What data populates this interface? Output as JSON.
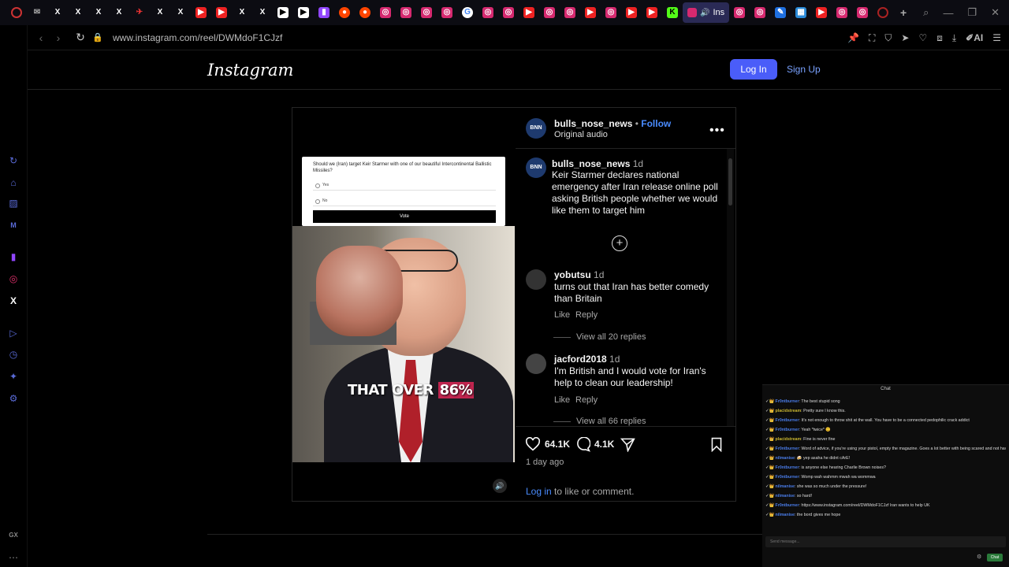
{
  "tabs": {
    "active_label": "Ins"
  },
  "address": {
    "url": "www.instagram.com/reel/DWMdoF1CJzf",
    "ai_label": "AI"
  },
  "header": {
    "logo": "Instagram",
    "login": "Log In",
    "signup": "Sign Up"
  },
  "video": {
    "poll_question": "Should we (Iran) target Keir Starmer with one of our beautiful Intercontinental Ballistic Missiles?",
    "poll_yes": "Yes",
    "poll_no": "No",
    "poll_vote": "Vote",
    "caption_prefix": "THAT OVER ",
    "caption_highlight": "86%"
  },
  "post": {
    "author": "bulls_nose_news",
    "author_avatar": "BNN",
    "follow": "Follow",
    "separator": "•",
    "audio": "Original audio",
    "more": "•••",
    "caption_author": "bulls_nose_news",
    "caption_age": "1d",
    "caption_text": "Keir Starmer declares national emergency after Iran release online poll asking British people whether we would like them to target him",
    "comments": [
      {
        "user": "yobutsu",
        "age": "1d",
        "text": "turns out that Iran has better comedy than Britain",
        "like": "Like",
        "reply": "Reply",
        "view_replies": "View all 20 replies"
      },
      {
        "user": "jacford2018",
        "age": "1d",
        "text": "I'm British and I would vote for Iran's help to clean our leadership!",
        "like": "Like",
        "reply": "Reply",
        "view_replies": "View all 66 replies"
      }
    ],
    "likes": "64.1K",
    "comment_count": "4.1K",
    "time": "1 day ago",
    "login_link": "Log in",
    "login_rest": " to like or comment."
  },
  "chat": {
    "title": "Chat",
    "placeholder": "Send message...",
    "send": "Chat",
    "messages": [
      {
        "user": "Fr0ntburner",
        "kind": "u",
        "text": "The best stupid song"
      },
      {
        "user": "placidstream",
        "kind": "p",
        "text": "Pretty sure I know this."
      },
      {
        "user": "Fr0ntburner",
        "kind": "u",
        "text": "It's not enough to throw shit at the wall. You have to be a connected pedophilic crack addict"
      },
      {
        "user": "Fr0ntburner",
        "kind": "u",
        "text": "Yeah *twice* 😊"
      },
      {
        "user": "placidstream",
        "kind": "p",
        "text": "Fine is never fine"
      },
      {
        "user": "Fr0ntburner",
        "kind": "u",
        "text": "Word of advice, if you're using your pistol, empty the magazine. Goes a lot better with being scared and not having a legal battle with a survivor"
      },
      {
        "user": "nilmanise",
        "kind": "u",
        "text": "🍻 yep asaha he didnt cArE!"
      },
      {
        "user": "Fr0ntburner",
        "kind": "u",
        "text": "is anyone else hearing Charlie Brown noises?"
      },
      {
        "user": "Fr0ntburner",
        "kind": "u",
        "text": "Womp wah wahmm mwah wa wommwa"
      },
      {
        "user": "nilmanise",
        "kind": "u",
        "text": "she was so much under the pressure!"
      },
      {
        "user": "nilmanise",
        "kind": "u",
        "text": "so hard!"
      },
      {
        "user": "Fr0ntburner",
        "kind": "u",
        "text": "https://www.instagram.com/reel/DWMdoF1CJzf Iran wants to help UK"
      },
      {
        "user": "nilmanise",
        "kind": "u",
        "text": "the bord gives me hope"
      }
    ]
  }
}
